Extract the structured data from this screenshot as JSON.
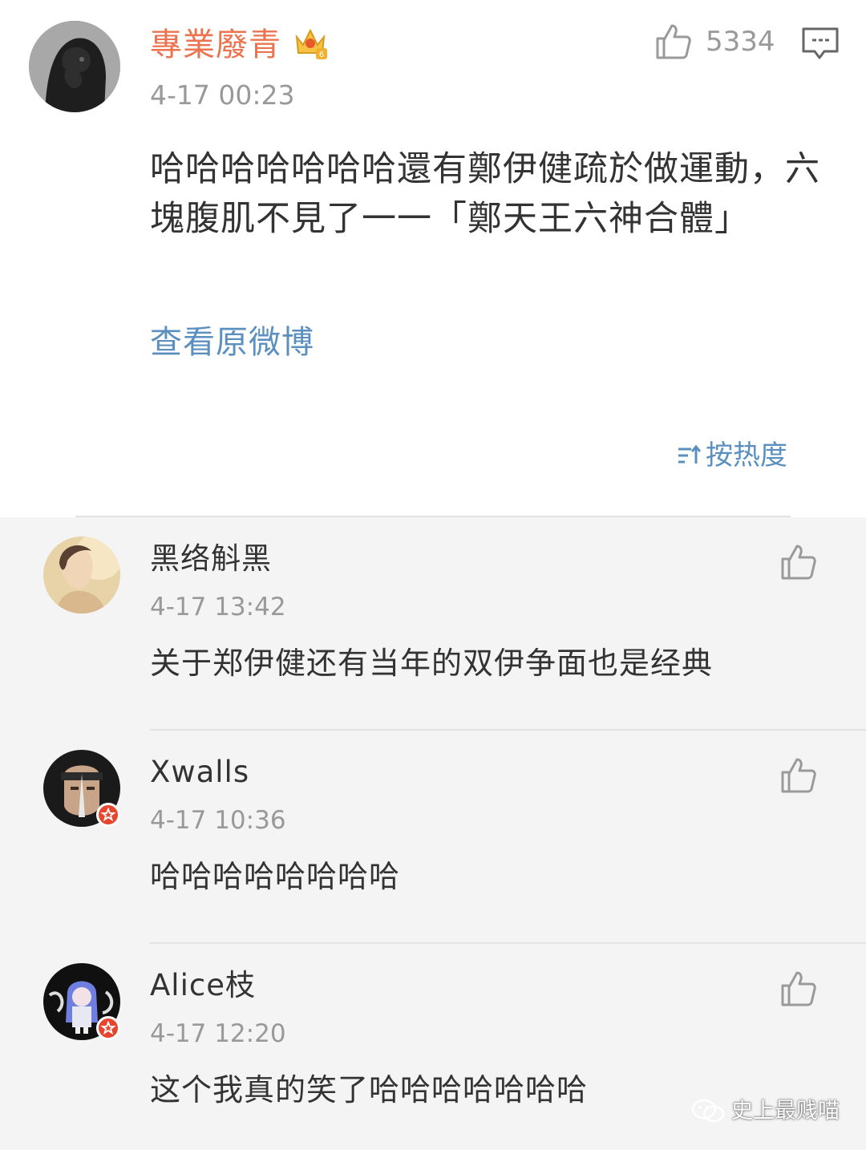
{
  "post": {
    "author": "專業廢青",
    "time": "4-17 00:23",
    "like_count": "5334",
    "text": "哈哈哈哈哈哈哈還有鄭伊健疏於做運動，六塊腹肌不見了一一「鄭天王六神合體」",
    "view_original": "查看原微博",
    "sort_label": "按热度"
  },
  "comments": [
    {
      "author": "黑络斛黑",
      "time": "4-17 13:42",
      "text": "关于郑伊健还有当年的双伊争面也是经典"
    },
    {
      "author": "Xwalls",
      "time": "4-17 10:36",
      "text": "哈哈哈哈哈哈哈哈"
    },
    {
      "author": "Alice枝",
      "time": "4-17 12:20",
      "text": "这个我真的笑了哈哈哈哈哈哈哈"
    }
  ],
  "watermark": "史上最贱喵",
  "colors": {
    "author_orange": "#eb7350",
    "link_blue": "#5b8fc0",
    "gray": "#999999",
    "badge_red": "#e6452e"
  },
  "icons": [
    "crown-icon",
    "like-icon",
    "comment-icon",
    "sort-icon",
    "wechat-icon"
  ]
}
